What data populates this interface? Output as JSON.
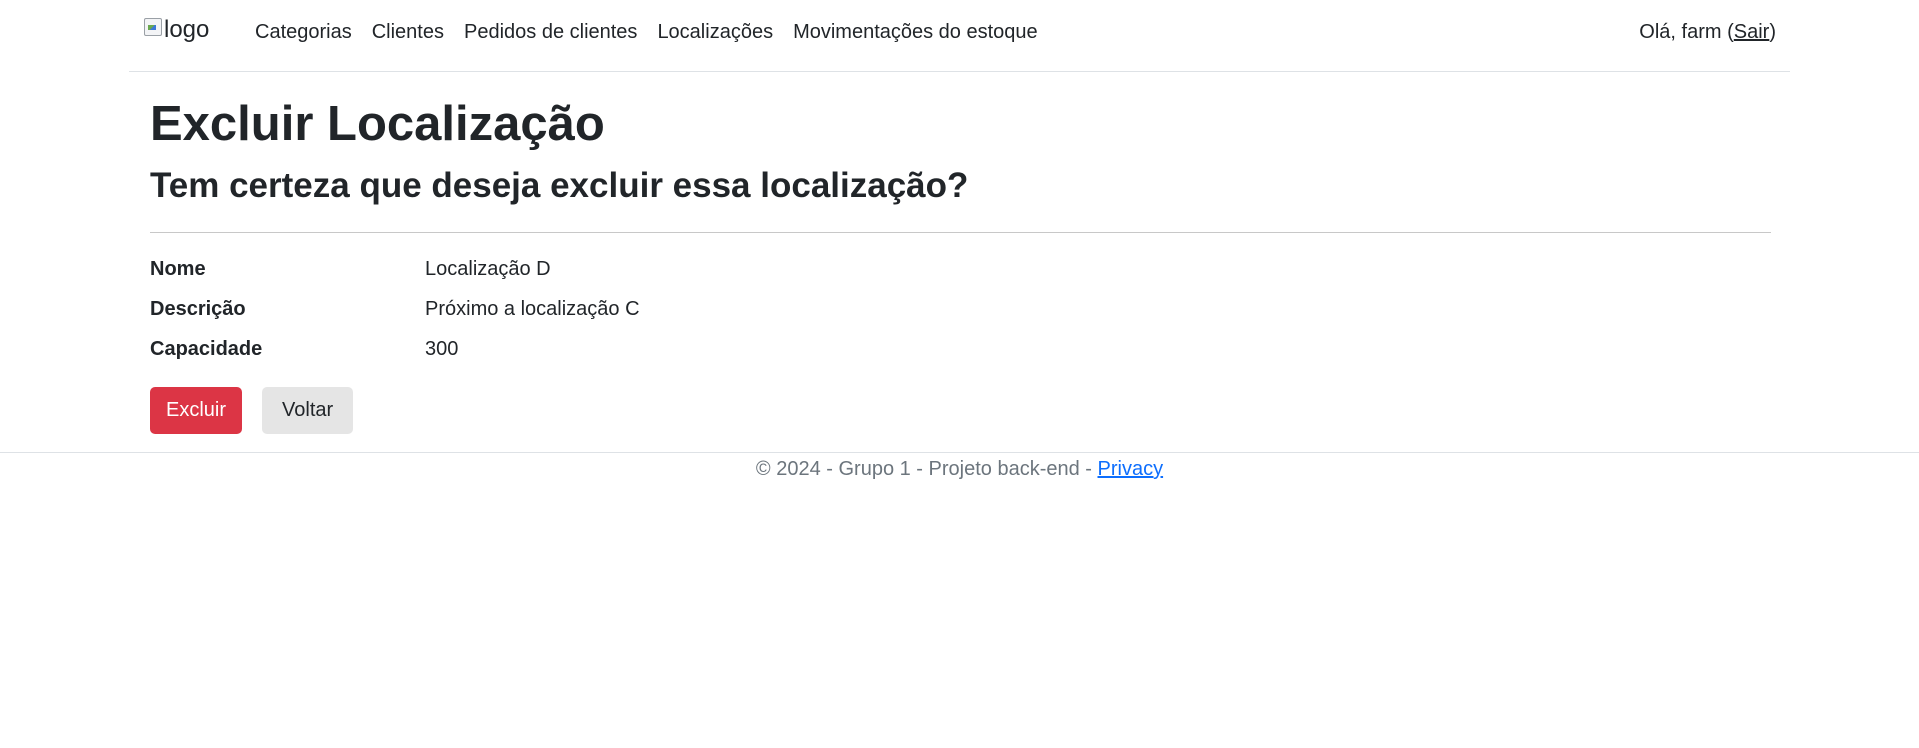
{
  "header": {
    "logo_alt": "logo",
    "nav": [
      {
        "label": "Categorias"
      },
      {
        "label": "Clientes"
      },
      {
        "label": "Pedidos de clientes"
      },
      {
        "label": "Localizações"
      },
      {
        "label": "Movimentações do estoque"
      }
    ],
    "greeting": "Olá, farm (",
    "logout_label": "Sair",
    "greeting_end": ")"
  },
  "page": {
    "title": "Excluir Localização",
    "confirm_question": "Tem certeza que deseja excluir essa localização?"
  },
  "details": [
    {
      "label": "Nome",
      "value": "Localização D"
    },
    {
      "label": "Descrição",
      "value": "Próximo a localização C"
    },
    {
      "label": "Capacidade",
      "value": "300"
    }
  ],
  "actions": {
    "delete_label": "Excluir",
    "back_label": "Voltar"
  },
  "footer": {
    "text": "© 2024 - Grupo 1 - Projeto back-end - ",
    "privacy_label": "Privacy"
  },
  "colors": {
    "danger": "#dc3545",
    "secondary": "#e5e5e5",
    "link": "#0d6efd",
    "muted": "#6c757d"
  }
}
